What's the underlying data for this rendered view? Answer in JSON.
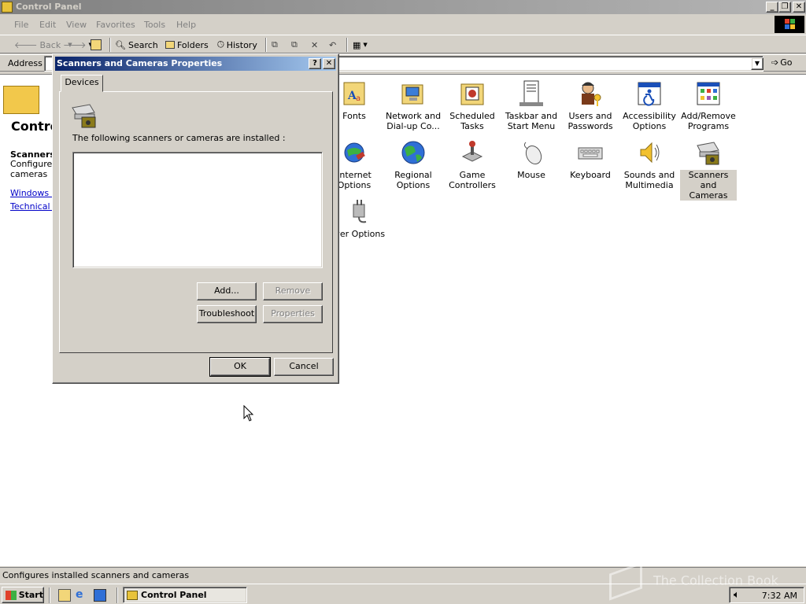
{
  "window": {
    "title": "Control Panel"
  },
  "menu": [
    "File",
    "Edit",
    "View",
    "Favorites",
    "Tools",
    "Help"
  ],
  "toolbar": {
    "back": "Back",
    "search": "Search",
    "folders": "Folders",
    "history": "History"
  },
  "address": {
    "label": "Address",
    "go": "Go"
  },
  "left_panel": {
    "title": "Contro",
    "selected_title": "Scanners",
    "selected_desc": "Configures cameras",
    "links": [
      "Windows U",
      "Technical S"
    ]
  },
  "icons": [
    {
      "label": "Fonts",
      "icon": "fonts-icon"
    },
    {
      "label": "Network and Dial-up Co...",
      "icon": "network-icon"
    },
    {
      "label": "Scheduled Tasks",
      "icon": "scheduled-tasks-icon"
    },
    {
      "label": "Taskbar and Start Menu",
      "icon": "taskbar-icon"
    },
    {
      "label": "Users and Passwords",
      "icon": "users-icon"
    },
    {
      "label": "Accessibility Options",
      "icon": "accessibility-icon"
    },
    {
      "label": "Add/Remove Programs",
      "icon": "add-remove-programs-icon"
    },
    {
      "label": "Internet Options",
      "icon": "internet-options-icon"
    },
    {
      "label": "Regional Options",
      "icon": "globe-icon"
    },
    {
      "label": "Game Controllers",
      "icon": "joystick-icon"
    },
    {
      "label": "Mouse",
      "icon": "mouse-icon"
    },
    {
      "label": "Keyboard",
      "icon": "keyboard-icon"
    },
    {
      "label": "Sounds and Multimedia",
      "icon": "speaker-icon"
    },
    {
      "label": "Scanners and Cameras",
      "icon": "scanner-icon"
    },
    {
      "label": "wer Options",
      "icon": "power-options-icon"
    }
  ],
  "status": "Configures installed scanners and cameras",
  "taskbar": {
    "start": "Start",
    "task": "Control Panel",
    "clock": "7:32 AM"
  },
  "watermark": "The Collection Book",
  "dialog": {
    "title": "Scanners and Cameras Properties",
    "tab": "Devices",
    "installed_text": "The following scanners or cameras are installed :",
    "buttons": {
      "add": "Add...",
      "remove": "Remove",
      "troubleshoot": "Troubleshoot",
      "properties": "Properties",
      "ok": "OK",
      "cancel": "Cancel"
    }
  }
}
